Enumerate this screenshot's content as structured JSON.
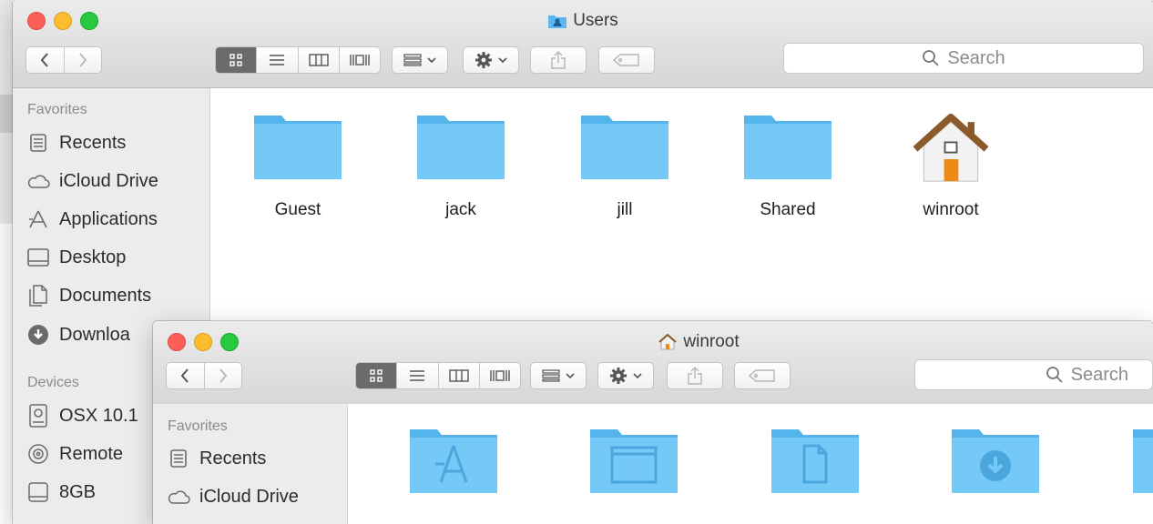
{
  "colors": {
    "folder": "#6cc5f6",
    "folder_dark": "#4eb1ea",
    "accent": "#1c8bf2"
  },
  "back_window": {
    "title": "Users",
    "title_icon": "users-folder-icon",
    "search_placeholder": "Search",
    "sidebar": {
      "favorites_title": "Favorites",
      "favorites": [
        {
          "label": "Recents",
          "icon": "recents-icon"
        },
        {
          "label": "iCloud Drive",
          "icon": "cloud-icon"
        },
        {
          "label": "Applications",
          "icon": "applications-icon"
        },
        {
          "label": "Desktop",
          "icon": "desktop-icon"
        },
        {
          "label": "Documents",
          "icon": "documents-icon"
        },
        {
          "label": "Downloa",
          "icon": "downloads-icon"
        }
      ],
      "devices_title": "Devices",
      "devices": [
        {
          "label": "OSX 10.1",
          "icon": "hard-disk-icon"
        },
        {
          "label": "Remote",
          "icon": "optical-disc-icon"
        },
        {
          "label": "8GB",
          "icon": "drive-icon"
        }
      ]
    },
    "items": [
      {
        "label": "Guest",
        "icon": "folder-icon"
      },
      {
        "label": "jack",
        "icon": "folder-icon"
      },
      {
        "label": "jill",
        "icon": "folder-icon"
      },
      {
        "label": "Shared",
        "icon": "folder-icon"
      },
      {
        "label": "winroot",
        "icon": "home-icon"
      }
    ]
  },
  "front_window": {
    "title": "winroot",
    "title_icon": "home-icon",
    "search_placeholder": "Search",
    "sidebar": {
      "favorites_title": "Favorites",
      "favorites": [
        {
          "label": "Recents",
          "icon": "recents-icon"
        },
        {
          "label": "iCloud Drive",
          "icon": "cloud-icon"
        }
      ]
    },
    "items": [
      {
        "icon": "applications-folder-icon"
      },
      {
        "icon": "desktop-folder-icon"
      },
      {
        "icon": "documents-folder-icon"
      },
      {
        "icon": "downloads-folder-icon"
      },
      {
        "icon": "folder-icon"
      }
    ]
  }
}
